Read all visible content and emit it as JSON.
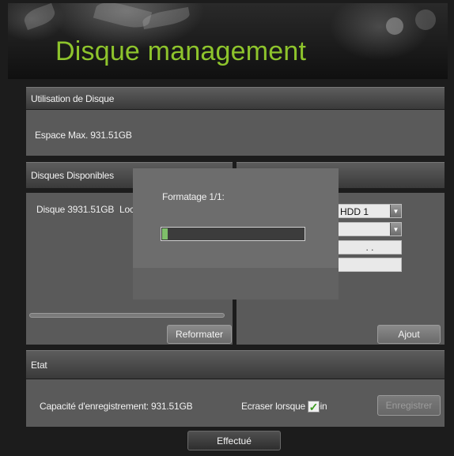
{
  "header": {
    "title": "Disque management"
  },
  "disk_usage": {
    "section_title": "Utilisation de Disque",
    "max_space": "Espace Max. 931.51GB"
  },
  "available_disks": {
    "section_title": "Disques Disponibles",
    "rows": [
      {
        "label": "Disque 3931.51GB",
        "type": "Loc"
      }
    ],
    "reformat_label": "Reformater"
  },
  "disk_settings": {
    "hdd_select": "HDD 1",
    "second_select": "",
    "ip_field": ".   .",
    "path_field": "",
    "add_label": "Ajout"
  },
  "format_dialog": {
    "message": "Formatage 1/1:",
    "progress": 0.04
  },
  "status": {
    "section_title": "Etat",
    "capacity": "Capacité d'enregistrement: 931.51GB",
    "overwrite_label": "Ecraser lorsque plein",
    "overwrite_checked": true,
    "save_label": "Enregistrer"
  },
  "footer": {
    "done_label": "Effectué"
  },
  "colors": {
    "title_green": "#8ec42c",
    "checkmark_green": "#3c9b1f",
    "progress_fill": "#7fbf6a"
  },
  "icons": [
    "dropdown-arrow-icon",
    "checkmark-icon"
  ]
}
